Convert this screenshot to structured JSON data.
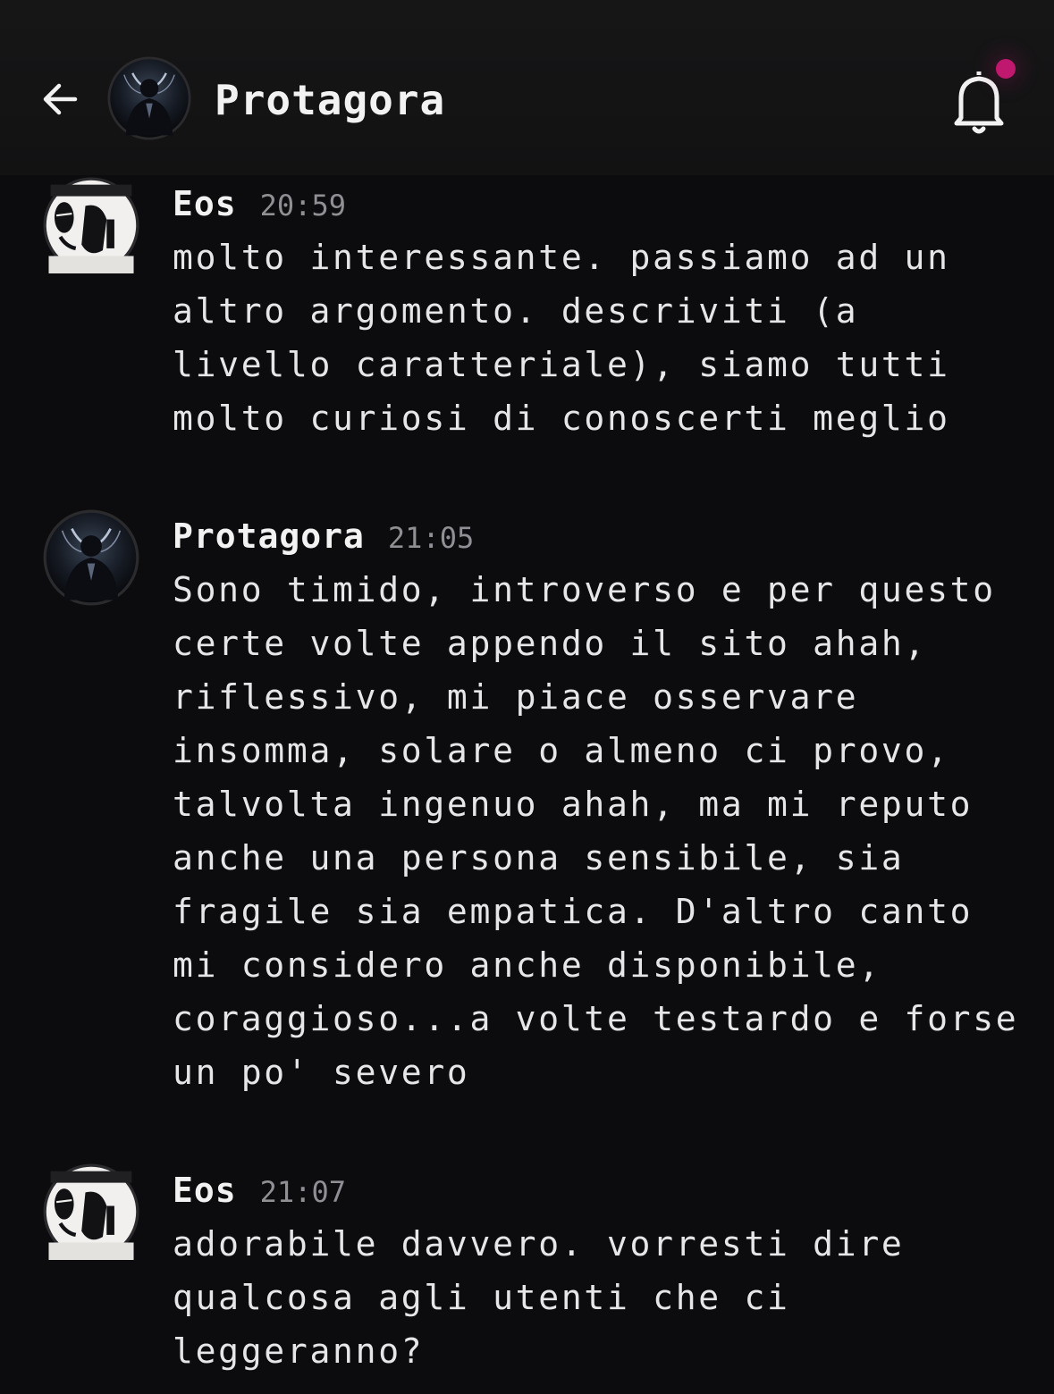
{
  "header": {
    "title": "Protagora",
    "back_icon": "arrow-left-icon",
    "bell_icon": "bell-icon",
    "notification_dot_color": "#c0186e"
  },
  "messages": [
    {
      "author": "Eos",
      "time": "20:59",
      "avatar": "eos-avatar",
      "lines": [
        "molto interessante. passiamo ad un",
        "altro argomento. descriviti (a",
        "livello caratteriale), siamo tutti",
        "molto curiosi di conoscerti meglio"
      ]
    },
    {
      "author": "Protagora",
      "time": "21:05",
      "avatar": "protagora-avatar",
      "lines": [
        "Sono timido, introverso e per questo",
        "certe volte appendo il sito ahah,",
        "riflessivo, mi piace osservare",
        "insomma, solare o almeno ci provo,",
        "talvolta ingenuo ahah, ma mi reputo",
        "anche una persona sensibile, sia",
        "fragile sia empatica. D'altro canto",
        "mi considero anche disponibile,",
        "coraggioso...a volte testardo e forse",
        "un po' severo"
      ]
    },
    {
      "author": "Eos",
      "time": "21:07",
      "avatar": "eos-avatar",
      "lines": [
        "adorabile davvero. vorresti dire",
        "qualcosa agli utenti che ci",
        "leggeranno?"
      ]
    }
  ]
}
